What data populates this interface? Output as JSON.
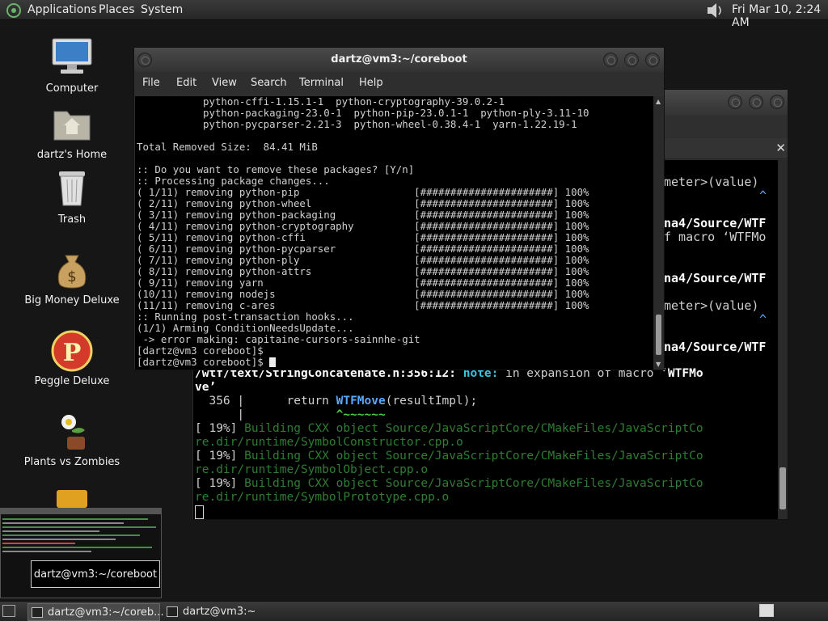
{
  "top_panel": {
    "menus": [
      "Applications",
      "Places",
      "System"
    ],
    "clock": "Fri Mar 10,  2:24 AM"
  },
  "desktop_icons": [
    "Computer",
    "dartz's Home",
    "Trash",
    "Big Money Deluxe",
    "Peggle Deluxe",
    "Plants vs Zombies"
  ],
  "front_window": {
    "title": "dartz@vm3:~/coreboot",
    "menu": [
      "File",
      "Edit",
      "View",
      "Search",
      "Terminal",
      "Help"
    ],
    "lines": [
      "           python-cffi-1.15.1-1  python-cryptography-39.0.2-1",
      "           python-packaging-23.0-1  python-pip-23.0.1-1  python-ply-3.11-10",
      "           python-pycparser-2.21-3  python-wheel-0.38.4-1  yarn-1.22.19-1",
      "",
      "Total Removed Size:  84.41 MiB",
      "",
      ":: Do you want to remove these packages? [Y/n]",
      ":: Processing package changes...",
      "( 1/11) removing python-pip                   [######################] 100%",
      "( 2/11) removing python-wheel                 [######################] 100%",
      "( 3/11) removing python-packaging             [######################] 100%",
      "( 4/11) removing python-cryptography          [######################] 100%",
      "( 5/11) removing python-cffi                  [######################] 100%",
      "( 6/11) removing python-pycparser             [######################] 100%",
      "( 7/11) removing python-ply                   [######################] 100%",
      "( 8/11) removing python-attrs                 [######################] 100%",
      "( 9/11) removing yarn                         [######################] 100%",
      "(10/11) removing nodejs                       [######################] 100%",
      "(11/11) removing c-ares                       [######################] 100%",
      ":: Running post-transaction hooks...",
      "(1/1) Arming ConditionNeedsUpdate...",
      " -> error making: capitaine-cursors-sainnhe-git",
      "[dartz@vm3 coreboot]$",
      "[dartz@vm3 coreboot]$ "
    ]
  },
  "back_window": {
    "right_fragments": [
      "meter>(value)",
      "^",
      "na4/Source/WTF",
      "f macro ‘WTFMo",
      "na4/Source/WTF",
      "meter>(value)",
      "^",
      "na4/Source/WTF"
    ],
    "lower_lines": [
      {
        "a": "/wtf/text/StringConcatenate.h:356:12: ",
        "b": "note:",
        "c": " in expansion of macro ‘",
        "d": "WTFMo"
      },
      {
        "a": "ve’",
        "b": "",
        "c": "",
        "d": ""
      }
    ],
    "code_line": {
      "num": "  356 |",
      "pre": "      return ",
      "fn": "WTFMove",
      "post": "(resultImpl);"
    },
    "caret_line": {
      "bar": "      |",
      "caret": "             ^~~~~~~"
    },
    "build_lines": [
      {
        "pct": "[ 19%] ",
        "text": "Building CXX object Source/JavaScriptCore/CMakeFiles/JavaScriptCo"
      },
      {
        "pct": "",
        "text": "re.dir/runtime/SymbolConstructor.cpp.o"
      },
      {
        "pct": "[ 19%] ",
        "text": "Building CXX object Source/JavaScriptCore/CMakeFiles/JavaScriptCo"
      },
      {
        "pct": "",
        "text": "re.dir/runtime/SymbolObject.cpp.o"
      },
      {
        "pct": "[ 19%] ",
        "text": "Building CXX object Source/JavaScriptCore/CMakeFiles/JavaScriptCo"
      },
      {
        "pct": "",
        "text": "re.dir/runtime/SymbolPrototype.cpp.o"
      }
    ]
  },
  "tooltip": "dartz@vm3:~/coreboot",
  "taskbar": [
    "dartz@vm3:~/coreb...",
    "dartz@vm3:~"
  ],
  "colors": {
    "note": "#33c7e6",
    "build": "#2e7d32",
    "wtfmove": "#5aa9ff",
    "caret": "#4ad04a"
  }
}
